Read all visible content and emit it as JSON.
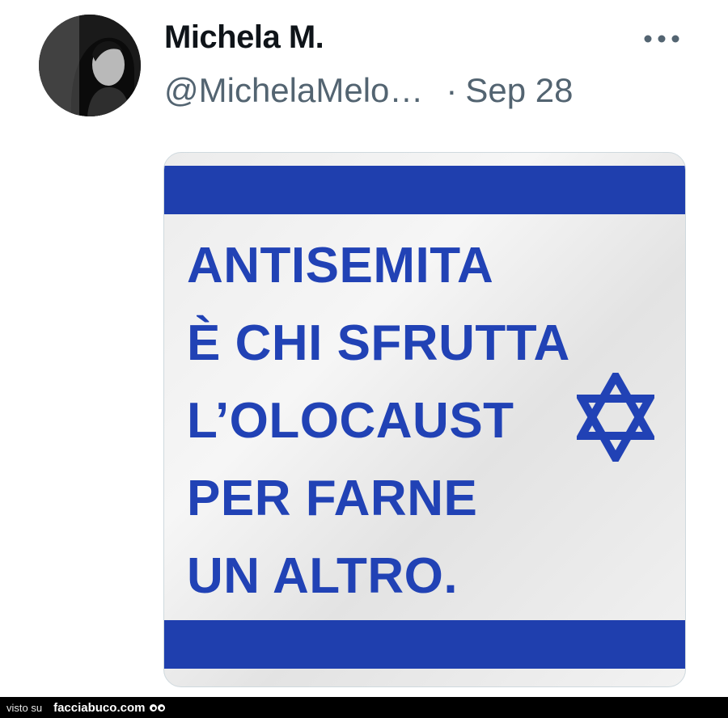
{
  "tweet": {
    "display_name": "Michela M.",
    "handle": "@MichelaMelo…",
    "separator": "·",
    "date": "Sep 28",
    "more_icon": "more-horizontal-icon",
    "avatar_icon": "profile-photo"
  },
  "media": {
    "lines": [
      "ANTISEMITA",
      "È CHI SFRUTTA",
      "L’OLOCAUST",
      "PER FARNE",
      "UN ALTRO."
    ],
    "star_icon": "star-of-david-icon",
    "colors": {
      "blue": "#1f3fae",
      "text_blue": "#2142b5"
    }
  },
  "footer": {
    "visto_label": "visto su",
    "site_label": "facciabuco.com"
  }
}
